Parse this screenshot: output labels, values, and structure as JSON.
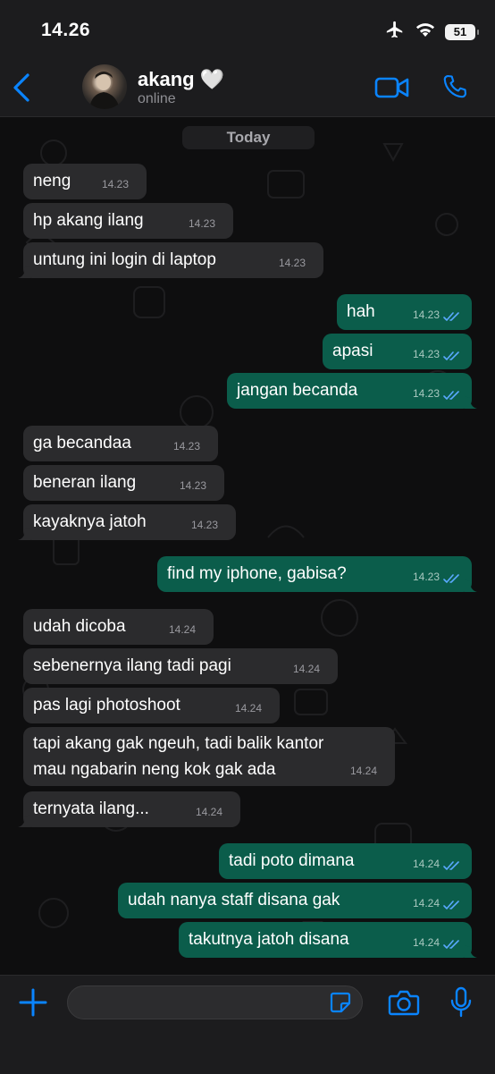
{
  "status_bar": {
    "time": "14.26",
    "battery": "51"
  },
  "header": {
    "name": "akang 🤍",
    "status": "online"
  },
  "chat": {
    "date_label": "Today",
    "messages": [
      {
        "dir": "in",
        "text": "neng",
        "time": "14.23"
      },
      {
        "dir": "in",
        "text": "hp akang ilang",
        "time": "14.23"
      },
      {
        "dir": "in",
        "text": "untung ini login di laptop",
        "time": "14.23"
      },
      {
        "dir": "out",
        "text": "hah",
        "time": "14.23"
      },
      {
        "dir": "out",
        "text": "apasi",
        "time": "14.23"
      },
      {
        "dir": "out",
        "text": "jangan becanda",
        "time": "14.23"
      },
      {
        "dir": "in",
        "text": "ga becandaa",
        "time": "14.23"
      },
      {
        "dir": "in",
        "text": "beneran ilang",
        "time": "14.23"
      },
      {
        "dir": "in",
        "text": "kayaknya jatoh",
        "time": "14.23"
      },
      {
        "dir": "out",
        "text": "find my iphone, gabisa?",
        "time": "14.23"
      },
      {
        "dir": "in",
        "text": "udah dicoba",
        "time": "14.24"
      },
      {
        "dir": "in",
        "text": "sebenernya ilang tadi pagi",
        "time": "14.24"
      },
      {
        "dir": "in",
        "text": "pas lagi photoshoot",
        "time": "14.24"
      },
      {
        "dir": "in",
        "text": "tapi akang gak ngeuh, tadi balik kantor\nmau ngabarin neng kok gak ada",
        "time": "14.24"
      },
      {
        "dir": "in",
        "text": "ternyata ilang...",
        "time": "14.24"
      },
      {
        "dir": "out",
        "text": "tadi poto dimana",
        "time": "14.24"
      },
      {
        "dir": "out",
        "text": "udah nanya staff disana gak",
        "time": "14.24"
      },
      {
        "dir": "out",
        "text": "takutnya jatoh disana",
        "time": "14.24"
      }
    ]
  },
  "input": {
    "placeholder": ""
  },
  "colors": {
    "accent": "#0a84ff",
    "outgoing_bubble": "#0b5d4b",
    "incoming_bubble": "#2b2b2d",
    "read_tick": "#5aa9ff"
  }
}
